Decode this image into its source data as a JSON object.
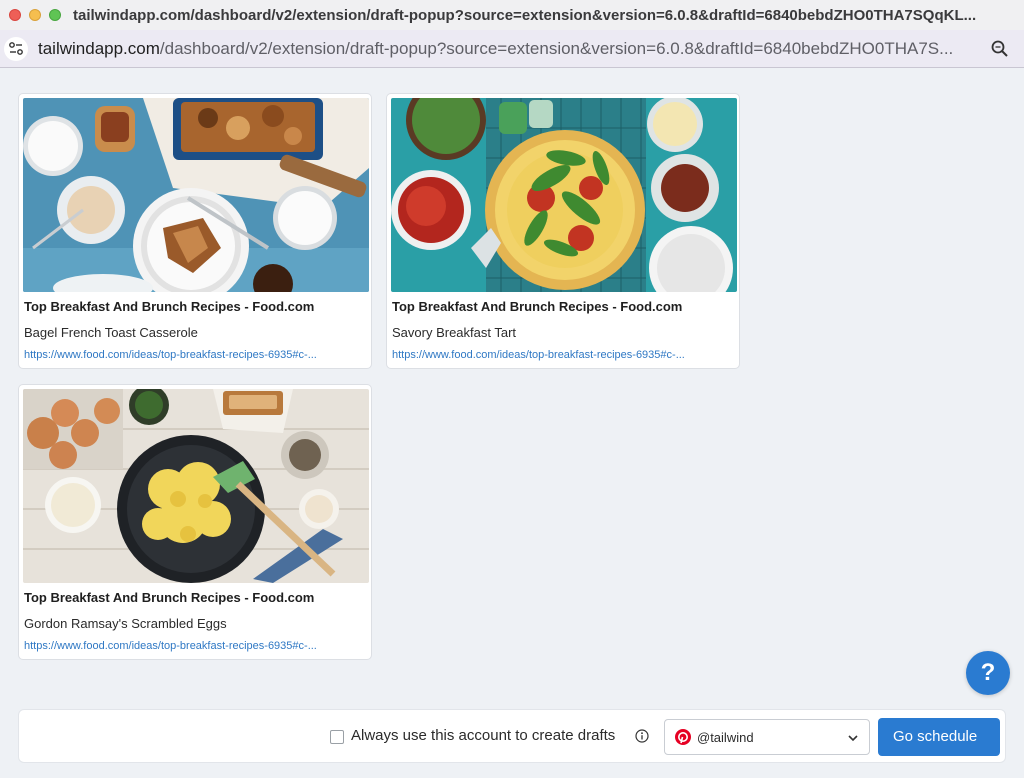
{
  "window": {
    "title": "tailwindapp.com/dashboard/v2/extension/draft-popup?source=extension&version=6.0.8&draftId=6840bebdZHO0THA7SQqKL..."
  },
  "address": {
    "domain": "tailwindapp.com",
    "path": "/dashboard/v2/extension/draft-popup?source=extension&version=6.0.8&draftId=6840bebdZHO0THA7S..."
  },
  "cards": [
    {
      "title": "Top Breakfast And Brunch Recipes - Food.com",
      "description": "Bagel French Toast Casserole",
      "link": "https://www.food.com/ideas/top-breakfast-recipes-6935#c-..."
    },
    {
      "title": "Top Breakfast And Brunch Recipes - Food.com",
      "description": "Savory Breakfast Tart",
      "link": "https://www.food.com/ideas/top-breakfast-recipes-6935#c-..."
    },
    {
      "title": "Top Breakfast And Brunch Recipes - Food.com",
      "description": "Gordon Ramsay's Scrambled Eggs",
      "link": "https://www.food.com/ideas/top-breakfast-recipes-6935#c-..."
    }
  ],
  "footer": {
    "checkbox_label": "Always use this account to create drafts",
    "checkbox_checked": false,
    "account": "@tailwind",
    "button_label": "Go schedule",
    "help_label": "?"
  },
  "colors": {
    "accent": "#2a7bd1",
    "link": "#2f78c4",
    "pinterest": "#e60023"
  }
}
